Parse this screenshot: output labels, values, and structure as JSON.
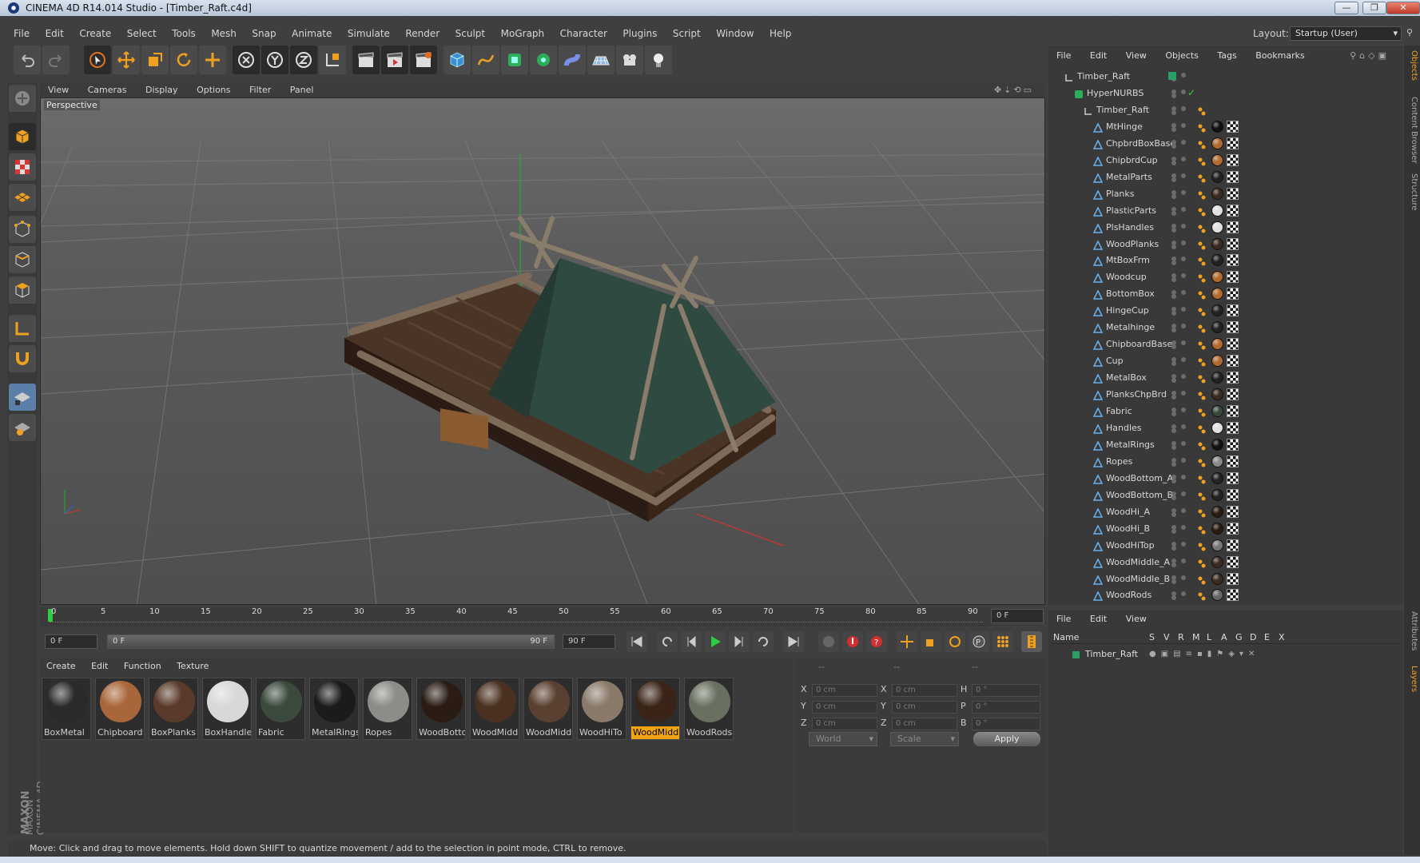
{
  "window": {
    "title": "CINEMA 4D R14.014 Studio - [Timber_Raft.c4d]",
    "minimize": "—",
    "restore": "❐",
    "close": "✕"
  },
  "menu": [
    "File",
    "Edit",
    "Create",
    "Select",
    "Tools",
    "Mesh",
    "Snap",
    "Animate",
    "Simulate",
    "Render",
    "Sculpt",
    "MoGraph",
    "Character",
    "Plugins",
    "Script",
    "Window",
    "Help"
  ],
  "layout": {
    "label": "Layout:",
    "value": "Startup (User)"
  },
  "viewport": {
    "menu": [
      "View",
      "Cameras",
      "Display",
      "Options",
      "Filter",
      "Panel"
    ],
    "label": "Perspective"
  },
  "timeline": {
    "ticks": [
      "0",
      "5",
      "10",
      "15",
      "20",
      "25",
      "30",
      "35",
      "40",
      "45",
      "50",
      "55",
      "60",
      "65",
      "70",
      "75",
      "80",
      "85",
      "90"
    ],
    "end_field": "0 F"
  },
  "playback": {
    "start": "0 F",
    "range_start": "0 F",
    "range_end": "90 F",
    "end": "90 F"
  },
  "materials": {
    "menu": [
      "Create",
      "Edit",
      "Function",
      "Texture"
    ],
    "items": [
      {
        "label": "BoxMetal",
        "color": "#2a2a2a"
      },
      {
        "label": "Chipboard",
        "color": "#a8663a"
      },
      {
        "label": "BoxPlanks",
        "color": "#5a3a2a"
      },
      {
        "label": "BoxHandle",
        "color": "#d8d8d8"
      },
      {
        "label": "Fabric",
        "color": "#3c4a3e"
      },
      {
        "label": "MetalRings",
        "color": "#1b1b1b"
      },
      {
        "label": "Ropes",
        "color": "#8c8c88"
      },
      {
        "label": "WoodBotto",
        "color": "#2a1c14"
      },
      {
        "label": "WoodMidd",
        "color": "#4a3020"
      },
      {
        "label": "WoodMidd",
        "color": "#5a4030"
      },
      {
        "label": "WoodHiTo",
        "color": "#8a7a6a"
      },
      {
        "label": "WoodMidd",
        "color": "#3a2418"
      },
      {
        "label": "WoodRods",
        "color": "#6a7060"
      }
    ]
  },
  "coords": {
    "headers": [
      "--",
      "--",
      "--"
    ],
    "rows": [
      {
        "a": "X",
        "av": "0 cm",
        "b": "X",
        "bv": "0 cm",
        "c": "H",
        "cv": "0 °"
      },
      {
        "a": "Y",
        "av": "0 cm",
        "b": "Y",
        "bv": "0 cm",
        "c": "P",
        "cv": "0 °"
      },
      {
        "a": "Z",
        "av": "0 cm",
        "b": "Z",
        "bv": "0 cm",
        "c": "B",
        "cv": "0 °"
      }
    ],
    "space": "World",
    "mode": "Scale",
    "apply": "Apply"
  },
  "status": "Move: Click and drag to move elements. Hold down SHIFT to quantize movement / add to the selection in point mode, CTRL to remove.",
  "objects": {
    "menu": [
      "File",
      "Edit",
      "View",
      "Objects",
      "Tags",
      "Bookmarks"
    ],
    "root": "Timber_Raft",
    "hypernurbs": "HyperNURBS",
    "group": "Timber_Raft",
    "items": [
      "MtHinge",
      "ChpbrdBoxBase",
      "ChipbrdCup",
      "MetalParts",
      "Planks",
      "PlasticParts",
      "PlsHandles",
      "WoodPlanks",
      "MtBoxFrm",
      "Woodcup",
      "BottomBox",
      "HingeCup",
      "Metalhinge",
      "ChipboardBase",
      "Cup",
      "MetalBox",
      "PlanksChpBrd",
      "Fabric",
      "Handles",
      "MetalRings",
      "Ropes",
      "WoodBottom_A",
      "WoodBottom_B",
      "WoodHi_A",
      "WoodHi_B",
      "WoodHiTop",
      "WoodMiddle_A",
      "WoodMiddle_B",
      "WoodRods"
    ],
    "tag_colors": [
      "#111",
      "#b06a30",
      "#b06a30",
      "#222",
      "#3a2a20",
      "#e0e0e0",
      "#e0e0e0",
      "#3a2a20",
      "#222",
      "#b06a30",
      "#b06a30",
      "#222",
      "#222",
      "#b06a30",
      "#b06a30",
      "#222",
      "#3a2a20",
      "#3a4a3a",
      "#e0e0e0",
      "#111",
      "#888",
      "#222",
      "#222",
      "#2a1a10",
      "#2a1a10",
      "#777",
      "#3a2a20",
      "#3a2a20",
      "#666"
    ]
  },
  "layers": {
    "menu": [
      "File",
      "Edit",
      "View"
    ],
    "columns": [
      "Name",
      "S",
      "V",
      "R",
      "M",
      "L",
      "A",
      "G",
      "D",
      "E",
      "X"
    ],
    "row": "Timber_Raft"
  },
  "sidetabs": [
    "Objects",
    "Content Browser",
    "Structure",
    "Attributes",
    "Layers"
  ],
  "brand": "MAXON CINEMA 4D"
}
